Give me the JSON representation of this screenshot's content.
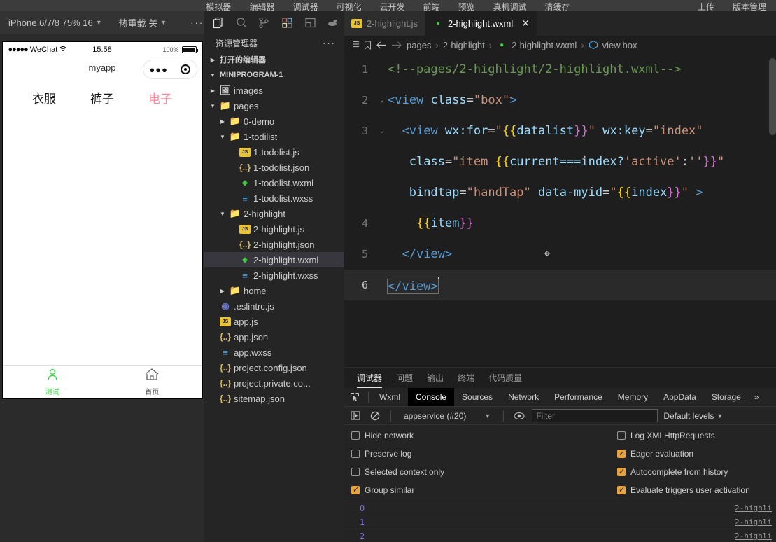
{
  "menubar": {
    "items": [
      "模拟器",
      "编辑器",
      "调试器",
      "可视化",
      "云开发",
      "前端",
      "预览",
      "真机调试",
      "清缓存"
    ],
    "right_items": [
      "上传",
      "版本管理"
    ]
  },
  "simulator": {
    "toolbar": {
      "device": "iPhone 6/7/8 75% 16",
      "hot_reload": "热重载 关",
      "more": "···"
    },
    "statusbar": {
      "carrier_dots": "●●●●●",
      "carrier": "WeChat",
      "wifi_icon": "wifi-icon",
      "time": "15:58",
      "battery_percent": "100%"
    },
    "nav_title": "myapp",
    "capsule": {
      "dots": "●●●",
      "target_icon": "target-icon"
    },
    "items": [
      {
        "label": "衣服",
        "active": false
      },
      {
        "label": "裤子",
        "active": false
      },
      {
        "label": "电子",
        "active": true
      }
    ],
    "tabbar": [
      {
        "icon": "person-icon",
        "label": "测试",
        "active": true
      },
      {
        "icon": "home-icon",
        "label": "首页",
        "active": false
      }
    ]
  },
  "activitybar": {
    "items": [
      {
        "name": "explorer-icon",
        "active": true
      },
      {
        "name": "search-icon",
        "active": false
      },
      {
        "name": "source-control-icon",
        "active": false
      },
      {
        "name": "extensions-icon",
        "active": false
      },
      {
        "name": "layout-icon",
        "active": false
      },
      {
        "name": "docker-icon",
        "active": false
      }
    ]
  },
  "sidebar": {
    "title": "资源管理器",
    "more": "···",
    "sections": [
      {
        "label": "打开的编辑器",
        "expanded": false
      },
      {
        "label": "MINIPROGRAM-1",
        "expanded": true
      }
    ],
    "tree": [
      {
        "label": "images",
        "type": "folder-img",
        "depth": 1,
        "expanded": false,
        "selected": false
      },
      {
        "label": "pages",
        "type": "folder-page",
        "depth": 1,
        "expanded": true,
        "selected": false
      },
      {
        "label": "0-demo",
        "type": "folder",
        "depth": 2,
        "expanded": false,
        "selected": false
      },
      {
        "label": "1-todilist",
        "type": "folder",
        "depth": 2,
        "expanded": true,
        "selected": false
      },
      {
        "label": "1-todolist.js",
        "type": "js",
        "depth": 3,
        "selected": false
      },
      {
        "label": "1-todolist.json",
        "type": "json",
        "depth": 3,
        "selected": false
      },
      {
        "label": "1-todolist.wxml",
        "type": "wxml",
        "depth": 3,
        "selected": false
      },
      {
        "label": "1-todolist.wxss",
        "type": "wxss",
        "depth": 3,
        "selected": false
      },
      {
        "label": "2-highlight",
        "type": "folder",
        "depth": 2,
        "expanded": true,
        "selected": false
      },
      {
        "label": "2-highlight.js",
        "type": "js",
        "depth": 3,
        "selected": false
      },
      {
        "label": "2-highlight.json",
        "type": "json",
        "depth": 3,
        "selected": false
      },
      {
        "label": "2-highlight.wxml",
        "type": "wxml",
        "depth": 3,
        "selected": true
      },
      {
        "label": "2-highlight.wxss",
        "type": "wxss",
        "depth": 3,
        "selected": false
      },
      {
        "label": "home",
        "type": "folder",
        "depth": 2,
        "expanded": false,
        "selected": false
      },
      {
        "label": ".eslintrc.js",
        "type": "eslint",
        "depth": 1,
        "selected": false
      },
      {
        "label": "app.js",
        "type": "js",
        "depth": 1,
        "selected": false
      },
      {
        "label": "app.json",
        "type": "json",
        "depth": 1,
        "selected": false
      },
      {
        "label": "app.wxss",
        "type": "wxss",
        "depth": 1,
        "selected": false
      },
      {
        "label": "project.config.json",
        "type": "json",
        "depth": 1,
        "selected": false
      },
      {
        "label": "project.private.co...",
        "type": "json",
        "depth": 1,
        "selected": false
      },
      {
        "label": "sitemap.json",
        "type": "json",
        "depth": 1,
        "selected": false
      }
    ]
  },
  "editor": {
    "tabs": [
      {
        "label": "2-highlight.js",
        "type": "js",
        "active": false,
        "closable": false
      },
      {
        "label": "2-highlight.wxml",
        "type": "wxml",
        "active": true,
        "closable": true
      }
    ],
    "breadcrumb": [
      {
        "label": "pages",
        "icon": ""
      },
      {
        "label": "2-highlight",
        "icon": ""
      },
      {
        "label": "2-highlight.wxml",
        "icon": "wxml-icon"
      },
      {
        "label": "view.box",
        "icon": "symbol-icon"
      }
    ],
    "lines": [
      {
        "num": "1",
        "fold": "",
        "current": false
      },
      {
        "num": "2",
        "fold": "⌄",
        "current": false
      },
      {
        "num": "3",
        "fold": "⌄",
        "current": false
      },
      {
        "num": "4",
        "fold": "",
        "current": false
      },
      {
        "num": "5",
        "fold": "",
        "current": false
      },
      {
        "num": "6",
        "fold": "",
        "current": true
      }
    ],
    "code_text": {
      "l1": "<!--pages/2-highlight/2-highlight.wxml-->",
      "l2_tag_open": "<view",
      "l2_attr": "class",
      "l2_eq": "=",
      "l2_val": "\"box\"",
      "l2_close": ">",
      "l3_tag_open": "<view",
      "l3_attr1": "wx:for",
      "l3_val1_q1": "\"",
      "l3_val1_brace": "{{",
      "l3_val1_inner": "datalist",
      "l3_val1_brace_close": "}}",
      "l3_val1_q2": "\"",
      "l3_attr2": "wx:key",
      "l3_val2": "\"index\"",
      "l3b_attr": "class",
      "l3b_str1": "\"item ",
      "l3b_brace": "{{",
      "l3b_expr": "current===index?",
      "l3b_active": "'active'",
      "l3b_colon": ":",
      "l3b_empty": "''",
      "l3b_brace_close": "}}",
      "l3b_q": "\"",
      "l3c_attr1": "bindtap",
      "l3c_val1": "\"handTap\"",
      "l3c_attr2": "data-myid",
      "l3c_q1": "\"",
      "l3c_brace": "{{",
      "l3c_inner": "index",
      "l3c_brace_close": "}}",
      "l3c_q2": "\"",
      "l3c_gt": ">",
      "l4_brace": "{{",
      "l4_inner": "item",
      "l4_brace_close": "}}",
      "l5": "</view>",
      "l6": "</view>"
    }
  },
  "panel": {
    "tabs": [
      {
        "label": "调试器",
        "active": true
      },
      {
        "label": "问题",
        "active": false
      },
      {
        "label": "输出",
        "active": false
      },
      {
        "label": "终端",
        "active": false
      },
      {
        "label": "代码质量",
        "active": false
      }
    ]
  },
  "devtools": {
    "tabs": [
      {
        "label": "Wxml",
        "active": false
      },
      {
        "label": "Console",
        "active": true
      },
      {
        "label": "Sources",
        "active": false
      },
      {
        "label": "Network",
        "active": false
      },
      {
        "label": "Performance",
        "active": false
      },
      {
        "label": "Memory",
        "active": false
      },
      {
        "label": "AppData",
        "active": false
      },
      {
        "label": "Storage",
        "active": false
      }
    ],
    "more": "»",
    "toolbar": {
      "sidebar_icon": "console-sidebar-icon",
      "clear_icon": "clear-console-icon",
      "context": "appservice (#20)",
      "eye_icon": "live-expression-icon",
      "filter_placeholder": "Filter",
      "filter_value": "",
      "levels": "Default levels"
    },
    "settings": [
      {
        "label": "Hide network",
        "checked": false
      },
      {
        "label": "Log XMLHttpRequests",
        "checked": false
      },
      {
        "label": "Preserve log",
        "checked": false
      },
      {
        "label": "Eager evaluation",
        "checked": true
      },
      {
        "label": "Selected context only",
        "checked": false
      },
      {
        "label": "Autocomplete from history",
        "checked": true
      },
      {
        "label": "Group similar",
        "checked": true
      },
      {
        "label": "Evaluate triggers user activation",
        "checked": true
      }
    ],
    "logs": [
      {
        "value": "0",
        "source": "2-highli"
      },
      {
        "value": "1",
        "source": "2-highli"
      },
      {
        "value": "2",
        "source": "2-highli"
      }
    ]
  },
  "colors": {
    "accent_pink": "#ff8a9b",
    "tab_green": "#3cd94a",
    "checkbox_orange": "#e8a33d",
    "editor_bg": "#1e1e1e",
    "sidebar_bg": "#252526"
  }
}
